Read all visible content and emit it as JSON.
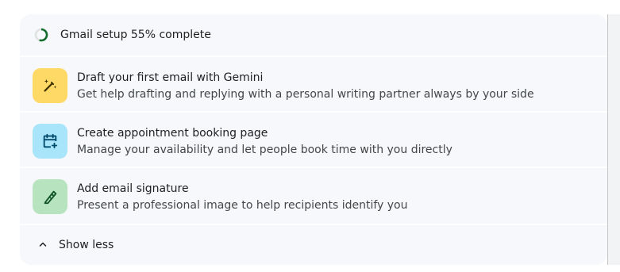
{
  "setup": {
    "header": "Gmail setup 55% complete",
    "progress": 0.55,
    "progress_color": "#146c2e",
    "track_color": "#dfe3e0"
  },
  "tasks": [
    {
      "title": "Draft your first email with Gemini",
      "description": "Get help drafting and replying with a personal writing partner always by your side",
      "icon": "magic-pen-icon",
      "icon_bg": "#ffd966"
    },
    {
      "title": "Create appointment booking page",
      "description": "Manage your availability and let people book time with you directly",
      "icon": "calendar-add-icon",
      "icon_bg": "#a8e4fa"
    },
    {
      "title": "Add email signature",
      "description": "Present a professional image to help recipients identify you",
      "icon": "signature-pen-icon",
      "icon_bg": "#b7e4be"
    }
  ],
  "footer": {
    "show_less_label": "Show less"
  }
}
